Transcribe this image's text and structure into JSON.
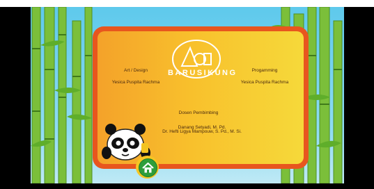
{
  "credits": {
    "art_title": "Art / Design",
    "art_name": "Yesica Puspita Rachma",
    "prog_title": "Progamming",
    "prog_name": "Yesica Puspita Rachma",
    "advisor_title": "Dosen Pembimbing",
    "advisor_1": "Danang Setyadi, M. Pd.",
    "advisor_2": "Dr. Hefti Ligya Mampouw, S. Pd., M. Si."
  },
  "logo": {
    "name": "BARUSIKUNG"
  },
  "home_button": {
    "icon": "home-icon"
  },
  "colors": {
    "panel_border": "#e8561e",
    "panel_fill_left": "#f4a22a",
    "panel_fill_right": "#f6d93a",
    "home_button": "#2e9e3a"
  }
}
